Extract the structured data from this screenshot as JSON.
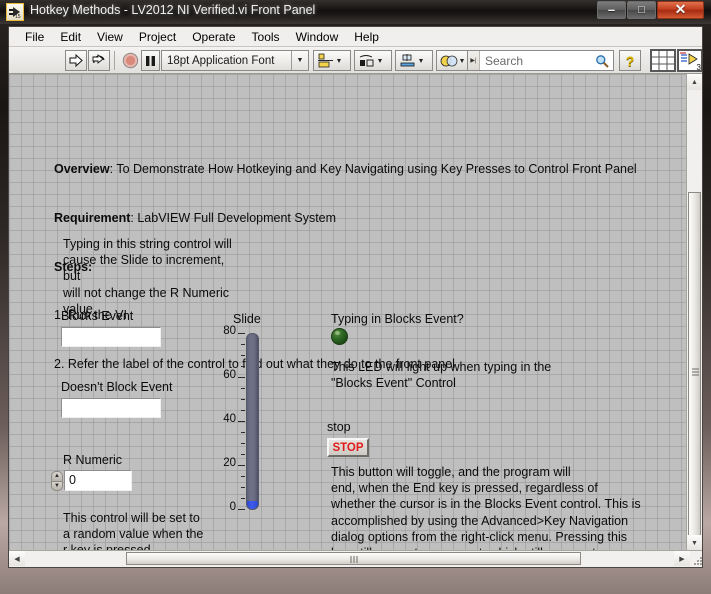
{
  "window": {
    "title": "Hotkey Methods - LV2012 NI Verified.vi Front Panel",
    "icon": "labview-vi-icon",
    "minimize_label": "–",
    "maximize_label": "□",
    "close_label": "✕"
  },
  "menubar": {
    "items": [
      {
        "label": "File"
      },
      {
        "label": "Edit"
      },
      {
        "label": "View"
      },
      {
        "label": "Project"
      },
      {
        "label": "Operate"
      },
      {
        "label": "Tools"
      },
      {
        "label": "Window"
      },
      {
        "label": "Help"
      }
    ]
  },
  "toolbar": {
    "run_icon": "run-arrow-icon",
    "run_continuous_icon": "run-continuously-icon",
    "abort_icon": "abort-execution-icon",
    "pause_icon": "pause-icon",
    "font_selector": "18pt Application Font",
    "font_dropdown_icon": "chevron-down-icon",
    "align_icon": "align-objects-icon",
    "distribute_icon": "distribute-objects-icon",
    "resize_icon": "resize-objects-icon",
    "reorder_icon": "reorder-objects-icon",
    "search_placeholder": "Search",
    "search_value": "",
    "search_icon": "magnifier-icon",
    "search_handle_icon": "drag-handle-icon",
    "help_icon": "question-mark-help-icon",
    "connector_grid_icon": "connector-pane-grid-icon",
    "vi_icon": "vi-icon",
    "vi_icon_badge": "3"
  },
  "panel": {
    "overview": {
      "overview_key": "Overview",
      "overview_value": ": To Demonstrate How Hotkeying and Key Navigating using Key Presses to Control Front Panel",
      "requirement_key": "Requirement",
      "requirement_value": ": LabVIEW Full Development System",
      "steps_key": "Steps:",
      "step1": "1. Run the VI",
      "step2": "2. Refer the label of the control to find out what they do to the front panel"
    },
    "string_note": "Typing in this string control will\ncause the Slide to increment, but\nwill not change the R Numeric\nvalue.",
    "blocks_event": {
      "label": "Blocks Event",
      "value": ""
    },
    "doesnt_block_event": {
      "label": "Doesn't Block Event",
      "value": ""
    },
    "r_numeric": {
      "label": "R Numeric",
      "value": "0",
      "increment_icon": "spin-up-icon",
      "decrement_icon": "spin-down-icon"
    },
    "r_numeric_note": "This control will be set to\na random value when the\nr key is pressed.",
    "slide": {
      "label": "Slide",
      "value": 0,
      "min": 0,
      "max": 88,
      "tick_labels": [
        "80",
        "60",
        "40",
        "20",
        "0"
      ],
      "tick_values": [
        80,
        60,
        40,
        20,
        0
      ]
    },
    "led": {
      "label": "Typing in Blocks Event?",
      "state": "off",
      "on_color": "#3fbb2a",
      "off_color": "#2f6a24"
    },
    "led_note": "This LED will light up when typing in the\n\"Blocks Event\" Control",
    "stop": {
      "label": "stop",
      "button_label": "STOP",
      "button_text_color": "#e21b1b"
    },
    "stop_note": "This button will toggle, and the program will\nend, when the End key is pressed, regardless of\nwhether the cursor is in the Blocks Event control. This is\naccomplished by using the Advanced>Key Navigation\ndialog options from the right-click menu. Pressing this\nkey still generates an event, which still propogates\nthrough the event structure."
  },
  "scrollbars": {
    "v_up_icon": "scroll-up-arrow-icon",
    "v_down_icon": "scroll-down-arrow-icon",
    "h_left_icon": "scroll-left-arrow-icon",
    "h_right_icon": "scroll-right-arrow-icon"
  }
}
